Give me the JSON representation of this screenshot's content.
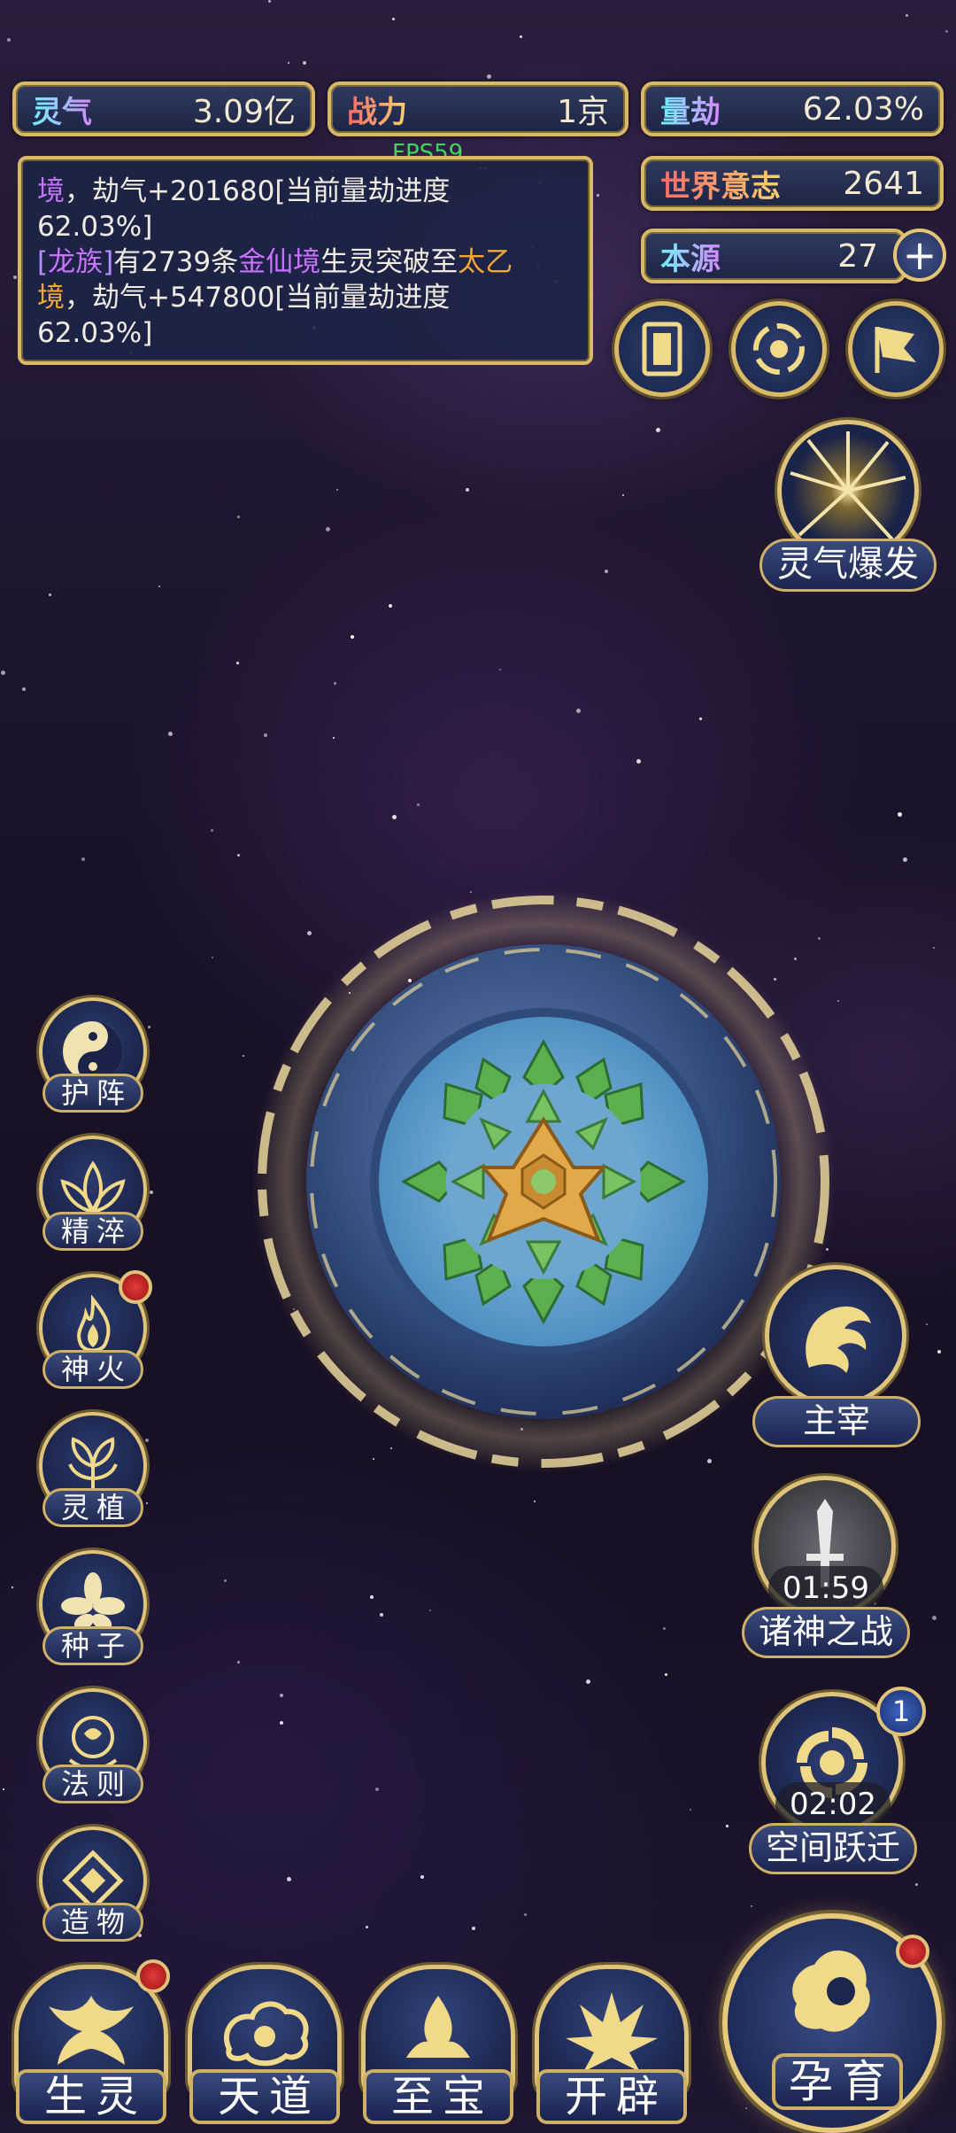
{
  "resources": {
    "lingqi": {
      "label": "灵气",
      "value": "3.09亿"
    },
    "zhanli": {
      "label": "战力",
      "value": "1京"
    },
    "liangjie": {
      "label": "量劫",
      "value": "62.03%"
    },
    "world_will": {
      "label": "世界意志",
      "value": "2641"
    },
    "benyuan": {
      "label": "本源",
      "value": "27"
    }
  },
  "fps": "FPS59",
  "log": {
    "line1_part1": "境",
    "line1_part2": "，劫气+201680[当前量劫进度",
    "line2": "62.03%]",
    "line3_bracket_open": "[",
    "line3_race": "龙族",
    "line3_bracket_close": "]",
    "line3_text1": "有2739条",
    "line3_realm1": "金仙境",
    "line3_text2": "生灵突破至",
    "line3_realm2a": "太乙",
    "line4_realm2b": "境",
    "line4_text": "，劫气+547800[当前量劫进度",
    "line5": "62.03%]"
  },
  "top_buttons": {
    "plus_icon": "plus-icon",
    "cards_icon": "cards-icon",
    "vortex_icon": "vortex-icon",
    "flag_icon": "flag-icon"
  },
  "burst": {
    "label": "灵气爆发"
  },
  "left_menu": [
    {
      "label": "护阵",
      "icon": "taiji-icon",
      "badge": false
    },
    {
      "label": "精淬",
      "icon": "lotus-icon",
      "badge": false
    },
    {
      "label": "神火",
      "icon": "flame-icon",
      "badge": true
    },
    {
      "label": "灵植",
      "icon": "plant-icon",
      "badge": false
    },
    {
      "label": "种子",
      "icon": "seed-icon",
      "badge": false
    },
    {
      "label": "法则",
      "icon": "law-icon",
      "badge": false
    },
    {
      "label": "造物",
      "icon": "create-icon",
      "badge": false
    }
  ],
  "right_menu": {
    "ruler": {
      "label": "主宰"
    },
    "war": {
      "label": "诸神之战",
      "timer": "01:59"
    },
    "jump": {
      "label": "空间跃迁",
      "timer": "02:02",
      "count": "1"
    }
  },
  "bottom_nav": [
    {
      "label": "生灵",
      "badge": true
    },
    {
      "label": "天道",
      "badge": false
    },
    {
      "label": "至宝",
      "badge": false
    },
    {
      "label": "开辟",
      "badge": false
    }
  ],
  "nurture": {
    "label": "孕育",
    "badge": true
  },
  "colors": {
    "gold": "#d9b866",
    "panel": "#1d2546",
    "accent_purple": "#c872ff",
    "accent_orange": "#f3a73a"
  }
}
